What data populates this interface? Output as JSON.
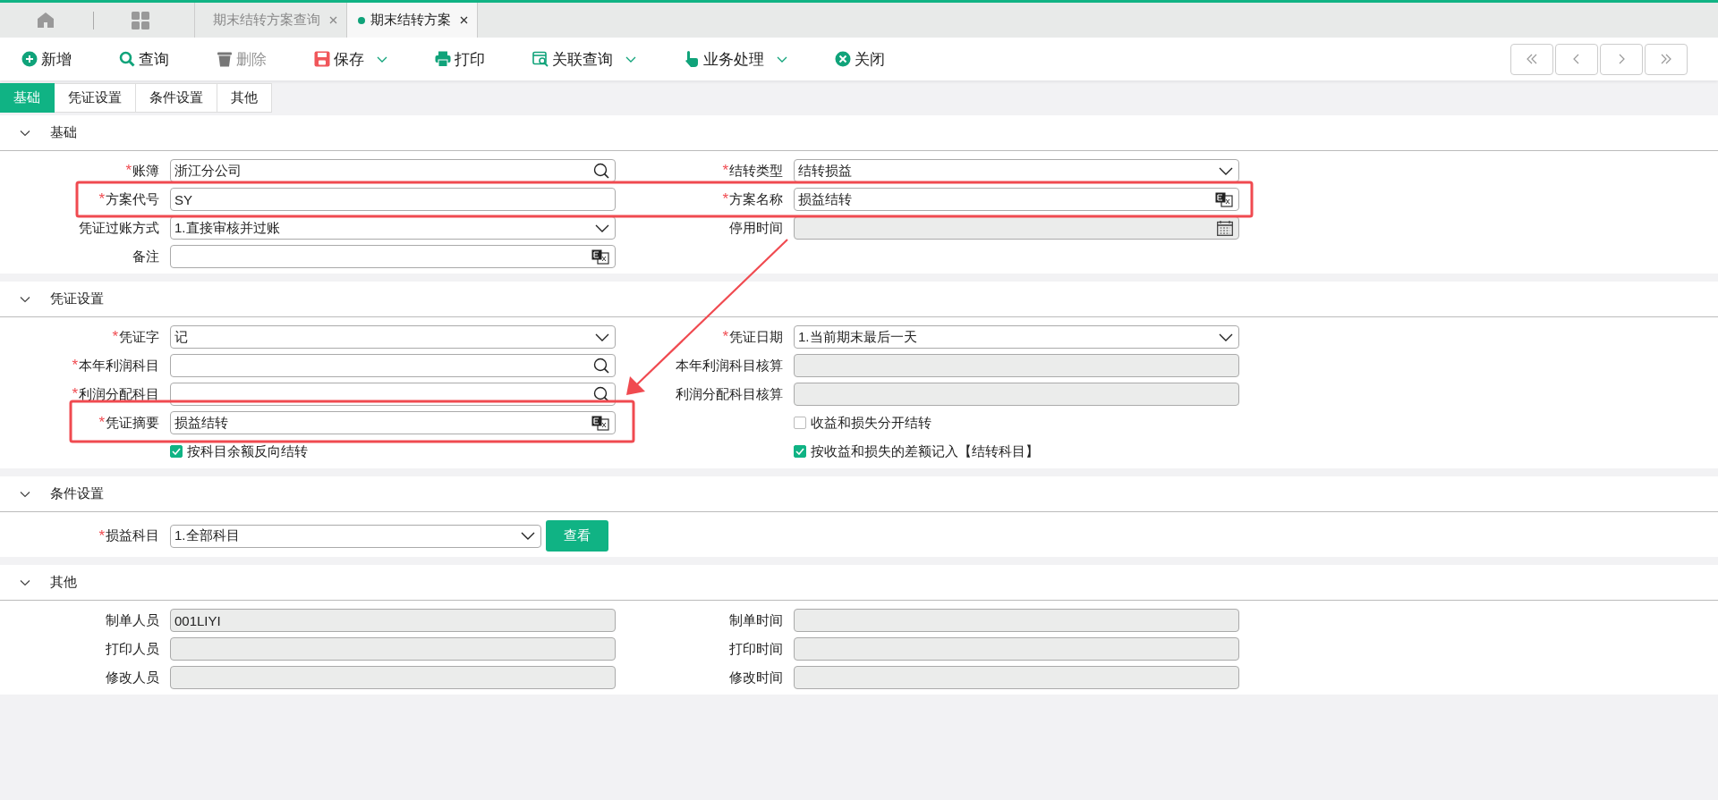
{
  "tabs": [
    {
      "label": "期末结转方案查询",
      "selected": false
    },
    {
      "label": "期末结转方案",
      "selected": true
    }
  ],
  "toolbar": [
    {
      "kind": "add",
      "label": "新增",
      "disabled": false,
      "dropdown": false
    },
    {
      "kind": "search",
      "label": "查询",
      "disabled": false,
      "dropdown": false
    },
    {
      "kind": "delete",
      "label": "删除",
      "disabled": true,
      "dropdown": false
    },
    {
      "kind": "save",
      "label": "保存",
      "disabled": false,
      "dropdown": true
    },
    {
      "kind": "print",
      "label": "打印",
      "disabled": false,
      "dropdown": false
    },
    {
      "kind": "related",
      "label": "关联查询",
      "disabled": false,
      "dropdown": true
    },
    {
      "kind": "handle",
      "label": "业务处理",
      "disabled": false,
      "dropdown": true
    },
    {
      "kind": "close",
      "label": "关闭",
      "disabled": false,
      "dropdown": false
    }
  ],
  "pager": [
    {
      "kind": "first"
    },
    {
      "kind": "prev"
    },
    {
      "kind": "next"
    },
    {
      "kind": "last"
    }
  ],
  "form_tabs": [
    {
      "label": "基础",
      "selected": true
    },
    {
      "label": "凭证设置",
      "selected": false
    },
    {
      "label": "条件设置",
      "selected": false
    },
    {
      "label": "其他",
      "selected": false
    }
  ],
  "sections": [
    {
      "title": "基础",
      "expanded": true,
      "rows": [
        [
          {
            "kind": "lookup",
            "label": "账簿",
            "required": "*",
            "value": "浙江分公司",
            "readonly": false
          },
          {
            "kind": "select",
            "label": "结转类型",
            "required": "*",
            "value": "结转损益",
            "readonly": false
          }
        ],
        [
          {
            "kind": "text",
            "label": "方案代号",
            "required": "*",
            "value": "SY",
            "readonly": false
          },
          {
            "kind": "translate",
            "label": "方案名称",
            "required": "*",
            "value": "损益结转",
            "readonly": false
          }
        ],
        [
          {
            "kind": "select",
            "label": "凭证过账方式",
            "value": "1.直接审核并过账",
            "readonly": false
          },
          {
            "kind": "date",
            "label": "停用时间",
            "readonly": true
          }
        ],
        [
          {
            "kind": "translate",
            "label": "备注",
            "readonly": false
          }
        ]
      ]
    },
    {
      "title": "凭证设置",
      "expanded": true,
      "rows": [
        [
          {
            "kind": "select",
            "label": "凭证字",
            "required": "*",
            "value": "记",
            "readonly": false
          },
          {
            "kind": "select",
            "label": "凭证日期",
            "required": "*",
            "value": "1.当前期末最后一天",
            "readonly": false
          }
        ],
        [
          {
            "kind": "lookup",
            "label": "本年利润科目",
            "required": "*",
            "readonly": false
          },
          {
            "kind": "text",
            "label": "本年利润科目核算",
            "readonly": true
          }
        ],
        [
          {
            "kind": "lookup",
            "label": "利润分配科目",
            "required": "*",
            "readonly": false
          },
          {
            "kind": "text",
            "label": "利润分配科目核算",
            "readonly": true
          }
        ],
        [
          {
            "kind": "translate",
            "label": "凭证摘要",
            "required": "*",
            "value": "损益结转",
            "readonly": false
          },
          {
            "kind": "checkbox",
            "label": "收益和损失分开结转",
            "checked": false
          }
        ],
        [
          {
            "kind": "checkbox",
            "label": "按科目余额反向结转",
            "checked": true
          },
          {
            "kind": "checkbox",
            "label": "按收益和损失的差额记入【结转科目】",
            "checked": true
          }
        ]
      ]
    },
    {
      "title": "条件设置",
      "expanded": true,
      "rows": [
        [
          {
            "kind": "select-button",
            "label": "损益科目",
            "required": "*",
            "value": "1.全部科目",
            "readonly": false,
            "button": "查看"
          }
        ]
      ]
    },
    {
      "title": "其他",
      "expanded": true,
      "rows": [
        [
          {
            "kind": "text",
            "label": "制单人员",
            "value": "001LIYI",
            "readonly": true
          },
          {
            "kind": "text",
            "label": "制单时间",
            "readonly": true
          }
        ],
        [
          {
            "kind": "text",
            "label": "打印人员",
            "readonly": true
          },
          {
            "kind": "text",
            "label": "打印时间",
            "readonly": true
          }
        ],
        [
          {
            "kind": "text",
            "label": "修改人员",
            "readonly": true
          },
          {
            "kind": "text",
            "label": "修改时间",
            "readonly": true
          }
        ]
      ]
    }
  ]
}
